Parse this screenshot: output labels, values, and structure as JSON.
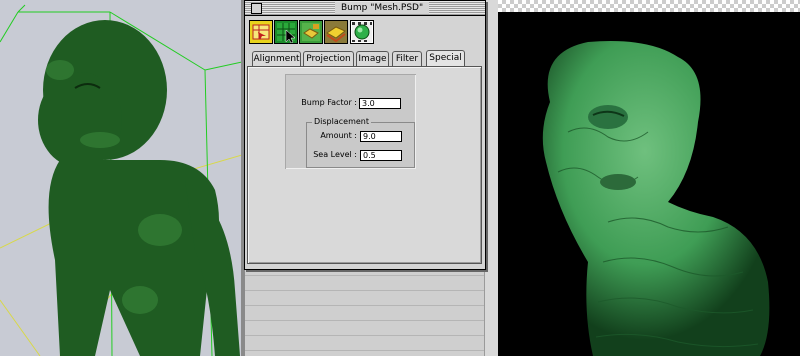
{
  "window": {
    "title": "Bump \"Mesh.PSD\""
  },
  "toolbar": {
    "tools": [
      {
        "name": "alignment-tool-icon"
      },
      {
        "name": "projection-tool-icon"
      },
      {
        "name": "image-tool-icon"
      },
      {
        "name": "filter-tool-icon"
      },
      {
        "name": "special-tool-icon"
      }
    ]
  },
  "tabs": [
    {
      "label": "Alignment",
      "active": false
    },
    {
      "label": "Projection",
      "active": false
    },
    {
      "label": "Image",
      "active": false
    },
    {
      "label": "Filter",
      "active": false
    },
    {
      "label": "Special",
      "active": true
    }
  ],
  "special": {
    "bump_factor_label": "Bump Factor :",
    "bump_factor_value": "3.0",
    "displacement_title": "Displacement",
    "amount_label": "Amount :",
    "amount_value": "9.0",
    "sea_level_label": "Sea Level :",
    "sea_level_value": "0.5"
  },
  "colors": {
    "model_green": "#1f5c22",
    "bounding_box": "#22cc22",
    "grid_line": "#d8d84a",
    "render_green": "#3f9d55"
  }
}
